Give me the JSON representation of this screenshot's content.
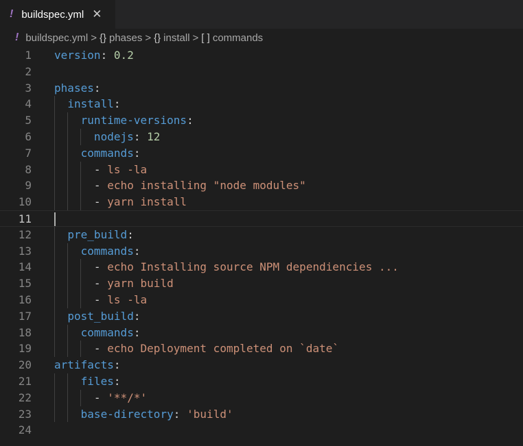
{
  "tab": {
    "file_icon": "yaml-exclamation-icon",
    "title": "buildspec.yml",
    "close_label": "✕"
  },
  "breadcrumb": {
    "items": [
      {
        "symbol": "!",
        "label": "buildspec.yml"
      },
      {
        "symbol": "{}",
        "label": "phases"
      },
      {
        "symbol": "{}",
        "label": "install"
      },
      {
        "symbol": "[ ]",
        "label": "commands"
      }
    ],
    "separator": ">"
  },
  "editor": {
    "current_line": 11,
    "lines": [
      {
        "n": "1",
        "tokens": [
          {
            "t": "k",
            "v": "version"
          },
          {
            "t": "p",
            "v": ": "
          },
          {
            "t": "n",
            "v": "0.2"
          }
        ]
      },
      {
        "n": "2",
        "tokens": []
      },
      {
        "n": "3",
        "tokens": [
          {
            "t": "k",
            "v": "phases"
          },
          {
            "t": "p",
            "v": ":"
          }
        ]
      },
      {
        "n": "4",
        "tokens": [
          {
            "t": "p",
            "v": "  "
          },
          {
            "t": "k",
            "v": "install"
          },
          {
            "t": "p",
            "v": ":"
          }
        ]
      },
      {
        "n": "5",
        "tokens": [
          {
            "t": "p",
            "v": "    "
          },
          {
            "t": "k",
            "v": "runtime-versions"
          },
          {
            "t": "p",
            "v": ":"
          }
        ]
      },
      {
        "n": "6",
        "tokens": [
          {
            "t": "p",
            "v": "      "
          },
          {
            "t": "k",
            "v": "nodejs"
          },
          {
            "t": "p",
            "v": ": "
          },
          {
            "t": "n",
            "v": "12"
          }
        ]
      },
      {
        "n": "7",
        "tokens": [
          {
            "t": "p",
            "v": "    "
          },
          {
            "t": "k",
            "v": "commands"
          },
          {
            "t": "p",
            "v": ":"
          }
        ]
      },
      {
        "n": "8",
        "tokens": [
          {
            "t": "p",
            "v": "      - "
          },
          {
            "t": "s",
            "v": "ls -la"
          }
        ]
      },
      {
        "n": "9",
        "tokens": [
          {
            "t": "p",
            "v": "      - "
          },
          {
            "t": "s",
            "v": "echo installing \"node modules\""
          }
        ]
      },
      {
        "n": "10",
        "tokens": [
          {
            "t": "p",
            "v": "      - "
          },
          {
            "t": "s",
            "v": "yarn install"
          }
        ]
      },
      {
        "n": "11",
        "tokens": []
      },
      {
        "n": "12",
        "tokens": [
          {
            "t": "p",
            "v": "  "
          },
          {
            "t": "k",
            "v": "pre_build"
          },
          {
            "t": "p",
            "v": ":"
          }
        ]
      },
      {
        "n": "13",
        "tokens": [
          {
            "t": "p",
            "v": "    "
          },
          {
            "t": "k",
            "v": "commands"
          },
          {
            "t": "p",
            "v": ":"
          }
        ]
      },
      {
        "n": "14",
        "tokens": [
          {
            "t": "p",
            "v": "      - "
          },
          {
            "t": "s",
            "v": "echo Installing source NPM dependiencies ..."
          }
        ]
      },
      {
        "n": "15",
        "tokens": [
          {
            "t": "p",
            "v": "      - "
          },
          {
            "t": "s",
            "v": "yarn build"
          }
        ]
      },
      {
        "n": "16",
        "tokens": [
          {
            "t": "p",
            "v": "      - "
          },
          {
            "t": "s",
            "v": "ls -la"
          }
        ]
      },
      {
        "n": "17",
        "tokens": [
          {
            "t": "p",
            "v": "  "
          },
          {
            "t": "k",
            "v": "post_build"
          },
          {
            "t": "p",
            "v": ":"
          }
        ]
      },
      {
        "n": "18",
        "tokens": [
          {
            "t": "p",
            "v": "    "
          },
          {
            "t": "k",
            "v": "commands"
          },
          {
            "t": "p",
            "v": ":"
          }
        ]
      },
      {
        "n": "19",
        "tokens": [
          {
            "t": "p",
            "v": "      - "
          },
          {
            "t": "s",
            "v": "echo Deployment completed on `date`"
          }
        ]
      },
      {
        "n": "20",
        "tokens": [
          {
            "t": "k",
            "v": "artifacts"
          },
          {
            "t": "p",
            "v": ":"
          }
        ]
      },
      {
        "n": "21",
        "tokens": [
          {
            "t": "p",
            "v": "    "
          },
          {
            "t": "k",
            "v": "files"
          },
          {
            "t": "p",
            "v": ":"
          }
        ]
      },
      {
        "n": "22",
        "tokens": [
          {
            "t": "p",
            "v": "      - "
          },
          {
            "t": "s",
            "v": "'**/*'"
          }
        ]
      },
      {
        "n": "23",
        "tokens": [
          {
            "t": "p",
            "v": "    "
          },
          {
            "t": "k",
            "v": "base-directory"
          },
          {
            "t": "p",
            "v": ": "
          },
          {
            "t": "s",
            "v": "'build'"
          }
        ]
      },
      {
        "n": "24",
        "tokens": []
      }
    ]
  },
  "colors": {
    "key": "#569cd6",
    "string": "#ce9178",
    "number": "#b5cea8",
    "punctuation": "#d4d4d4",
    "yaml_icon": "#a074c4",
    "background": "#1e1e1e"
  }
}
